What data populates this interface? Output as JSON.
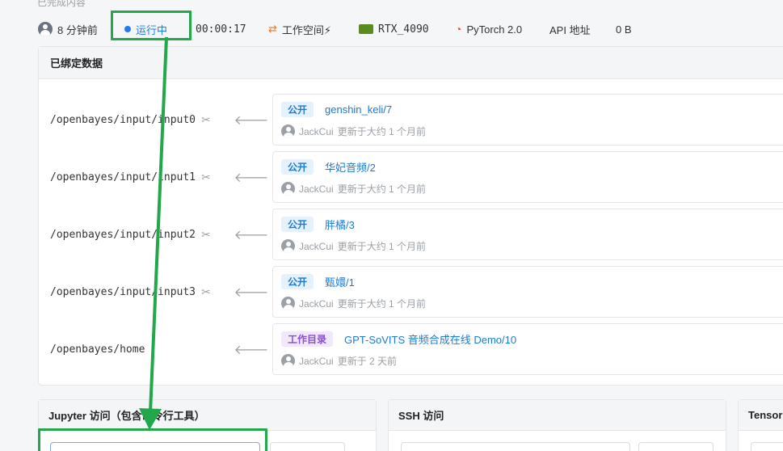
{
  "top_cut_text": "已完成内容",
  "status": {
    "time_ago": "8 分钟前",
    "state": "运行中",
    "elapsed": "00:00:17",
    "workspace": "工作空间⚡",
    "gpu": "RTX_4090",
    "framework": "PyTorch 2.0",
    "api_label": "API 地址",
    "size": "0 B"
  },
  "bound_data": {
    "title": "已绑定数据",
    "rows": [
      {
        "path": "/openbayes/input/input0",
        "tag": "公开",
        "name": "genshin_keli/7",
        "user": "JackCui",
        "updated": "更新于大约 1 个月前"
      },
      {
        "path": "/openbayes/input/input1",
        "tag": "公开",
        "name": "华妃音频/2",
        "user": "JackCui",
        "updated": "更新于大约 1 个月前"
      },
      {
        "path": "/openbayes/input/input2",
        "tag": "公开",
        "name": "胖橘/3",
        "user": "JackCui",
        "updated": "更新于大约 1 个月前"
      },
      {
        "path": "/openbayes/input/input3",
        "tag": "公开",
        "name": "甄嬛/1",
        "user": "JackCui",
        "updated": "更新于大约 1 个月前"
      },
      {
        "path": "/openbayes/home",
        "tag": "工作目录",
        "name": "GPT-SoVITS 音频合成在线 Demo/10",
        "user": "JackCui",
        "updated": "更新于 2 天前"
      }
    ]
  },
  "access": {
    "jupyter": "Jupyter 访问（包含命令行工具）",
    "ssh": "SSH 访问",
    "tensorboard": "Tensor"
  },
  "colors": {
    "accent": "#1e7df0",
    "highlight": "#22a74a"
  }
}
